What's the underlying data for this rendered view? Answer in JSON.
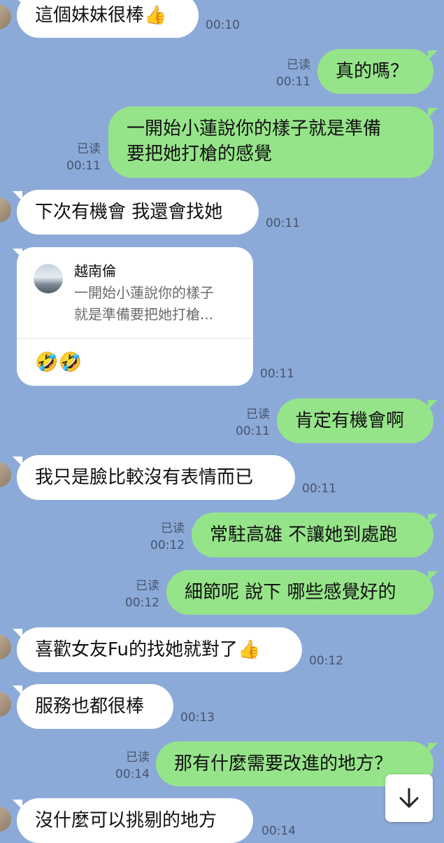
{
  "messages": [
    {
      "text": "這個妹妹很棒👍",
      "time": "00:10"
    },
    {
      "text": "真的嗎？",
      "time": "00:11",
      "read": "已读"
    },
    {
      "lines": [
        "一開始小蓮說你的樣子就是準備",
        "要把她打槍的感覺"
      ],
      "time": "00:11",
      "read": "已读"
    },
    {
      "text": "下次有機會 我還會找她",
      "time": "00:11"
    },
    {
      "reply": {
        "name": "越南倫",
        "lines": [
          "一開始小蓮說你的樣子",
          "就是準備要把她打槍..."
        ]
      },
      "text": "🤣🤣",
      "time": "00:11"
    },
    {
      "text": "肯定有機會啊",
      "time": "00:11",
      "read": "已读"
    },
    {
      "text": "我只是臉比較沒有表情而已",
      "time": "00:11"
    },
    {
      "text": "常駐高雄 不讓她到處跑",
      "time": "00:12",
      "read": "已读"
    },
    {
      "text": "細節呢 說下 哪些感覺好的",
      "time": "00:12",
      "read": "已读"
    },
    {
      "text": "喜歡女友Fu的找她就對了👍",
      "time": "00:12"
    },
    {
      "text": "服務也都很棒",
      "time": "00:13"
    },
    {
      "text": "那有什麼需要改進的地方？",
      "time": "00:14",
      "read": "已读"
    },
    {
      "text": "沒什麼可以挑剔的地方",
      "time": "00:14"
    }
  ],
  "scroll_button": {
    "icon": "arrow-down-icon"
  }
}
